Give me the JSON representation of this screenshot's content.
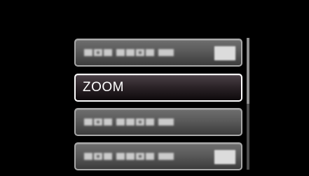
{
  "menu": {
    "items": [
      {
        "label": "",
        "has_value": true,
        "selected": false
      },
      {
        "label": "ZOOM",
        "has_value": false,
        "selected": true
      },
      {
        "label": "",
        "has_value": false,
        "selected": false
      },
      {
        "label": "",
        "has_value": true,
        "selected": false
      }
    ]
  },
  "scroll": {
    "position_fraction": 0.0,
    "visible_fraction": 0.5
  },
  "colors": {
    "background": "#000000",
    "item_border": "#a9a9a9",
    "selected_border": "#ffffff",
    "text": "#ffffff"
  }
}
